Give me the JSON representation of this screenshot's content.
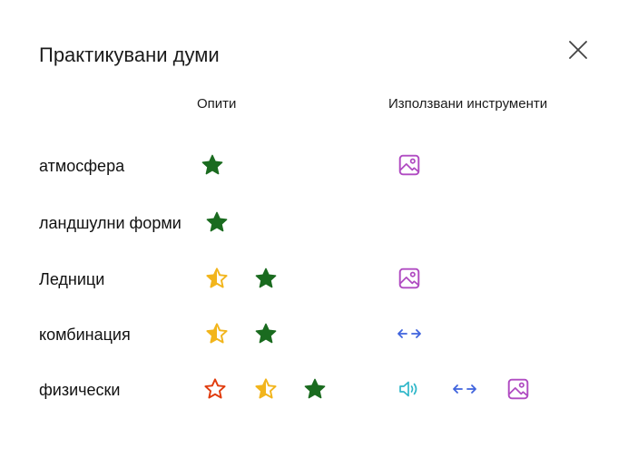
{
  "dialog": {
    "title": "Практикувани думи",
    "close_label": "×"
  },
  "headers": {
    "attempts": "Опити",
    "tools": "Използвани инструменти"
  },
  "colors": {
    "star_green": "#1a6b1f",
    "star_yellow": "#f2b51c",
    "star_red": "#e03c0e",
    "picture_icon": "#b04bc2",
    "arrows_icon": "#3f63dd",
    "speaker_icon": "#2fb7c9"
  },
  "rows": [
    {
      "word": "атмосфера",
      "attempts": [
        "green-star-icon"
      ],
      "tools": [
        "picture-icon"
      ]
    },
    {
      "word": "ландшулни форми",
      "attempts": [
        "green-star-icon"
      ],
      "tools": []
    },
    {
      "word": "Ледници",
      "attempts": [
        "half-yellow-star-icon",
        "green-star-icon"
      ],
      "tools": [
        "picture-icon"
      ]
    },
    {
      "word": "комбинация",
      "attempts": [
        "half-yellow-star-icon",
        "green-star-icon"
      ],
      "tools": [
        "syllable-arrows-icon"
      ]
    },
    {
      "word": "физически",
      "attempts": [
        "red-star-outline-icon",
        "half-yellow-star-icon",
        "green-star-icon"
      ],
      "tools": [
        "speaker-icon",
        "syllable-arrows-icon",
        "picture-icon"
      ]
    }
  ]
}
